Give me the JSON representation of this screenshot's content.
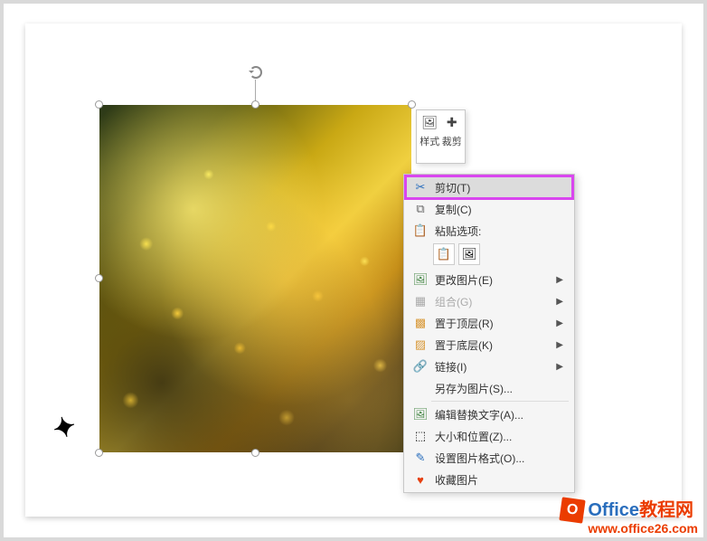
{
  "mini_toolbar": {
    "style": {
      "label": "样式"
    },
    "crop": {
      "label": "裁剪"
    }
  },
  "context_menu": {
    "cut": "剪切(T)",
    "copy": "复制(C)",
    "paste_options_header": "粘贴选项:",
    "change_picture": "更改图片(E)",
    "group": "组合(G)",
    "bring_to_front": "置于顶层(R)",
    "send_to_back": "置于底层(K)",
    "link": "链接(I)",
    "save_as_picture": "另存为图片(S)...",
    "edit_alt_text": "编辑替换文字(A)...",
    "size_and_position": "大小和位置(Z)...",
    "format_picture": "设置图片格式(O)...",
    "favorite_picture": "收藏图片"
  },
  "watermark": {
    "title_prefix": "Office",
    "title_suffix": "教程网",
    "url": "www.office26.com"
  }
}
